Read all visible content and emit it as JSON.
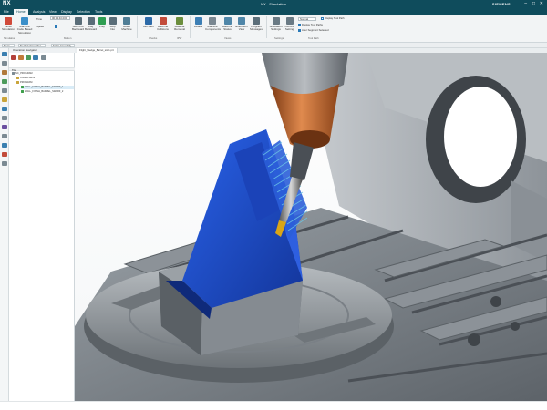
{
  "app": {
    "logo": "NX",
    "window_title": "NX - Simulation",
    "brand": "SIEMENS",
    "controls": {
      "minimize": "–",
      "maximize": "□",
      "close": "✕"
    }
  },
  "menu": {
    "tabs": [
      "File",
      "Home",
      "Analysis",
      "View",
      "Display",
      "Selection",
      "Tools"
    ],
    "active": "Home"
  },
  "ribbon": {
    "buttons": [
      {
        "label": "Finish Simulation",
        "icon": "finish-icon"
      },
      {
        "label": "Machine Code Based Simulation",
        "icon": "machine-code-icon"
      },
      {
        "label": "Step Into Backward",
        "icon": "step-back-icon"
      },
      {
        "label": "Play Backward",
        "icon": "play-back-icon"
      },
      {
        "label": "Play",
        "icon": "play-icon"
      },
      {
        "label": "Step Into",
        "icon": "step-into-icon"
      },
      {
        "label": "Reset Machine",
        "icon": "reset-icon"
      },
      {
        "label": "Tool Path",
        "icon": "tool-path-icon"
      },
      {
        "label": "Machine Collisions",
        "icon": "collisions-icon"
      },
      {
        "label": "Material Removal",
        "icon": "material-removal-icon"
      },
      {
        "label": "Details",
        "icon": "details-icon"
      },
      {
        "label": "Machine Components",
        "icon": "components-icon"
      },
      {
        "label": "Machine Status",
        "icon": "status-icon"
      },
      {
        "label": "Execution View",
        "icon": "execution-icon"
      },
      {
        "label": "Program Messages",
        "icon": "messages-icon"
      },
      {
        "label": "Simulation Settings",
        "icon": "sim-settings-icon"
      },
      {
        "label": "Current Setting",
        "icon": "current-setting-icon"
      }
    ],
    "time_label": "Time",
    "time_value": "00:13:40.000",
    "speed_label": "Speed",
    "motion_label": "Motion",
    "toolpath_dropdown": "Normal",
    "groups": [
      "Simulation",
      "Checks",
      "IPW",
      "Views",
      "Settings",
      "Tool Path"
    ],
    "checkboxes": [
      {
        "label": "Display Tool Path",
        "checked": false
      },
      {
        "label": "Display Tool Paths",
        "checked": true
      },
      {
        "label": "After Segment Selected",
        "checked": true
      }
    ]
  },
  "selection_bar": {
    "menu": "Menu",
    "filter": "No Selection Filter",
    "scope": "Entire Assembly"
  },
  "navigator": {
    "title": "Operation Navigator",
    "column": "Title",
    "items": [
      {
        "label": "NC_PROGRAM",
        "level": 0,
        "icon": "program-icon",
        "selected": false
      },
      {
        "label": "Unused Items",
        "level": 1,
        "icon": "folder-icon",
        "selected": false
      },
      {
        "label": "PROGRAM",
        "level": 1,
        "icon": "program-icon",
        "selected": false
      },
      {
        "label": "WALL_FINISH_BARREL_SWARF_1",
        "level": 2,
        "icon": "operation-icon",
        "selected": true
      },
      {
        "label": "WALL_FINISH_BARREL_SWARF_2",
        "level": 2,
        "icon": "operation-icon",
        "selected": false
      }
    ]
  },
  "viewport": {
    "tab": "Flight_Wedge_Barrel_sim1.prt"
  },
  "colors": {
    "titlebar": "#0f4c5c",
    "ribbon": "#f2f4f5",
    "part_blue": "#1f4fd0",
    "spindle_copper": "#c8703a",
    "fixture_gray": "#7d8389",
    "toolpath": "#6cc7e6"
  }
}
